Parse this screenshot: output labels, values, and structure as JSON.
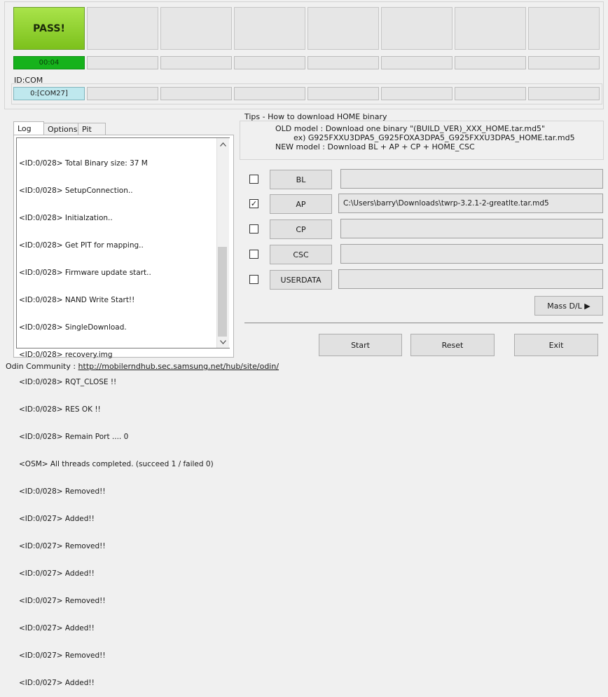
{
  "status": {
    "pass_label": "PASS!",
    "timer": "00:04",
    "id_com_label": "ID:COM",
    "com_port": "0:[COM27]"
  },
  "tabs": [
    "Log",
    "Options",
    "Pit"
  ],
  "log_lines": [
    "<ID:0/028> Total Binary size: 37 M",
    "<ID:0/028> SetupConnection..",
    "<ID:0/028> Initialzation..",
    "<ID:0/028> Get PIT for mapping..",
    "<ID:0/028> Firmware update start..",
    "<ID:0/028> NAND Write Start!!",
    "<ID:0/028> SingleDownload.",
    "<ID:0/028> recovery.img",
    "<ID:0/028> RQT_CLOSE !!",
    "<ID:0/028> RES OK !!",
    "<ID:0/028> Remain Port .... 0",
    "<OSM> All threads completed. (succeed 1 / failed 0)",
    "<ID:0/028> Removed!!",
    "<ID:0/027> Added!!",
    "<ID:0/027> Removed!!",
    "<ID:0/027> Added!!",
    "<ID:0/027> Removed!!",
    "<ID:0/027> Added!!",
    "<ID:0/027> Removed!!",
    "<ID:0/027> Added!!"
  ],
  "tips": {
    "title": "Tips - How to download HOME binary",
    "old_model": "OLD model  : Download one binary    \"(BUILD_VER)_XXX_HOME.tar.md5\"",
    "old_example": "ex) G925FXXU3DPA5_G925FOXA3DPA5_G925FXXU3DPA5_HOME.tar.md5",
    "new_model": "NEW model : Download BL + AP + CP + HOME_CSC"
  },
  "files": [
    {
      "label": "BL",
      "checked": false,
      "path": ""
    },
    {
      "label": "AP",
      "checked": true,
      "path": "C:\\Users\\barry\\Downloads\\twrp-3.2.1-2-greatlte.tar.md5"
    },
    {
      "label": "CP",
      "checked": false,
      "path": ""
    },
    {
      "label": "CSC",
      "checked": false,
      "path": ""
    },
    {
      "label": "USERDATA",
      "checked": false,
      "path": ""
    }
  ],
  "buttons": {
    "mass_dl": "Mass D/L ▶",
    "start": "Start",
    "reset": "Reset",
    "exit": "Exit"
  },
  "footer": {
    "label": "Odin Community : ",
    "link": "http://mobilerndhub.sec.samsung.net/hub/site/odin/"
  },
  "colors": {
    "pass": "#8fd12a",
    "progress": "#16b21c",
    "com_active": "#bfe8ee"
  }
}
